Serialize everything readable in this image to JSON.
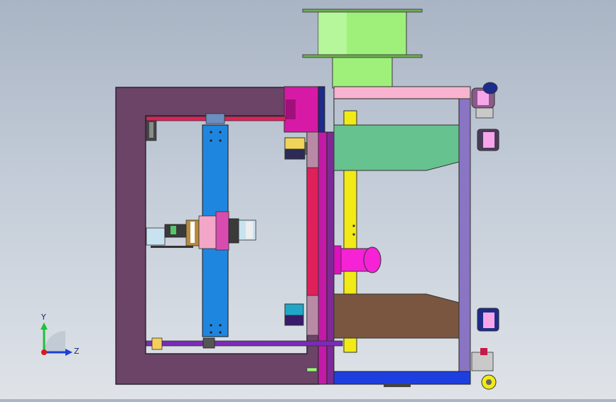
{
  "viewport": {
    "background_top": "#a9b4c4",
    "background_bottom": "#dfe3e8"
  },
  "model": {
    "colors": {
      "frame": "#6b4468",
      "frame_edge": "#2a1a2a",
      "spool": "#9ef07a",
      "spool_shadow": "#5fc24a",
      "top_bar": "#f7b3cf",
      "blue_beam": "#1f86e0",
      "red_rail": "#e0205a",
      "purple_rail": "#7a2bb8",
      "magenta_block": "#d61aa6",
      "navy_post": "#1c2b8c",
      "yellow_post": "#f2ea16",
      "green_plate": "#66c28e",
      "brown_plate": "#7a5540",
      "lavender_post": "#8a74c4",
      "base_blue": "#1e3fe0",
      "pink_motor": "#f522d6"
    }
  },
  "triad": {
    "y_label": "Y",
    "z_label": "Z",
    "y_color": "#1fbf3a",
    "z_color": "#1c3fd6",
    "x_color": "#d61a1a"
  }
}
